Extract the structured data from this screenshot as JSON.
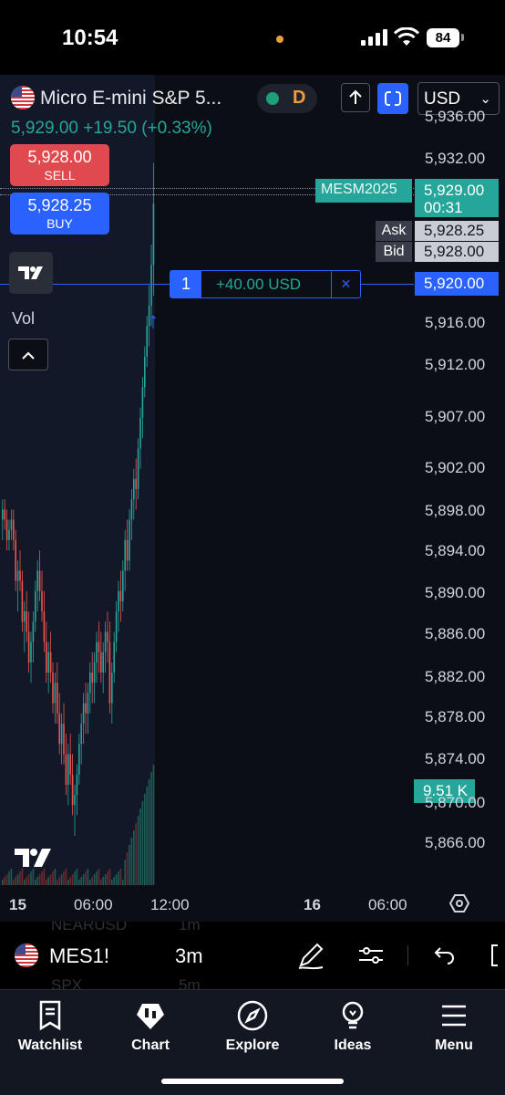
{
  "status_bar": {
    "time": "10:54",
    "battery": "84"
  },
  "chart_header": {
    "symbol_name": "Micro E-mini S&P 5...",
    "market_status": "D",
    "currency": "USD",
    "last_price": "5,929.00",
    "change": "+19.50",
    "change_pct": "(+0.33%)"
  },
  "trade_buttons": {
    "sell_price": "5,928.00",
    "sell_label": "SELL",
    "buy_price": "5,928.25",
    "buy_label": "BUY"
  },
  "indicators": {
    "vol_label": "Vol"
  },
  "price_axis": {
    "ticks": [
      "5,936.00",
      "5,932.00",
      "5,916.00",
      "5,912.00",
      "5,907.00",
      "5,902.00",
      "5,898.00",
      "5,894.00",
      "5,890.00",
      "5,886.00",
      "5,882.00",
      "5,878.00",
      "5,874.00",
      "5,870.00",
      "5,866.00"
    ]
  },
  "price_labels": {
    "contract": "MESM2025",
    "last": "5,929.00",
    "countdown": "00:31",
    "ask_label": "Ask",
    "ask": "5,928.25",
    "bid_label": "Bid",
    "bid": "5,928.00",
    "position_price": "5,920.00",
    "volume": "9.51 K"
  },
  "position": {
    "qty": "1",
    "pnl": "+40.00 USD",
    "close": "×"
  },
  "time_axis": {
    "labels": [
      "15",
      "06:00",
      "12:00",
      "16",
      "06:00"
    ]
  },
  "symbol_bar": {
    "ticker": "MES1!",
    "interval": "3m",
    "ghost_top_left": "NEARUSD",
    "ghost_top_right": "1m",
    "ghost_bottom_left": "SPX",
    "ghost_bottom_right": "5m"
  },
  "bottom_nav": {
    "items": [
      {
        "label": "Watchlist",
        "icon": "watchlist-icon"
      },
      {
        "label": "Chart",
        "icon": "chart-icon"
      },
      {
        "label": "Explore",
        "icon": "compass-icon"
      },
      {
        "label": "Ideas",
        "icon": "lightbulb-icon"
      },
      {
        "label": "Menu",
        "icon": "hamburger-icon"
      }
    ]
  },
  "colors": {
    "up": "#26a69a",
    "down": "#ef5350",
    "accent": "#2962ff",
    "warning": "#f29d38"
  },
  "candles": [
    [
      5898,
      5900,
      5896,
      5899
    ],
    [
      5899,
      5900,
      5897,
      5898
    ],
    [
      5898,
      5899,
      5895,
      5896
    ],
    [
      5896,
      5898,
      5895,
      5897
    ],
    [
      5897,
      5899,
      5896,
      5898
    ],
    [
      5898,
      5899,
      5895,
      5896
    ],
    [
      5896,
      5897,
      5891,
      5892
    ],
    [
      5892,
      5894,
      5889,
      5893
    ],
    [
      5893,
      5895,
      5891,
      5892
    ],
    [
      5892,
      5893,
      5887,
      5888
    ],
    [
      5888,
      5890,
      5885,
      5889
    ],
    [
      5889,
      5891,
      5886,
      5887
    ],
    [
      5887,
      5889,
      5883,
      5884
    ],
    [
      5884,
      5887,
      5882,
      5886
    ],
    [
      5886,
      5889,
      5884,
      5888
    ],
    [
      5888,
      5892,
      5887,
      5891
    ],
    [
      5891,
      5894,
      5889,
      5893
    ],
    [
      5893,
      5895,
      5890,
      5891
    ],
    [
      5891,
      5893,
      5888,
      5889
    ],
    [
      5889,
      5891,
      5885,
      5886
    ],
    [
      5886,
      5888,
      5882,
      5883
    ],
    [
      5883,
      5886,
      5881,
      5885
    ],
    [
      5885,
      5887,
      5882,
      5883
    ],
    [
      5883,
      5884,
      5879,
      5880
    ],
    [
      5880,
      5883,
      5878,
      5882
    ],
    [
      5882,
      5884,
      5878,
      5879
    ],
    [
      5879,
      5881,
      5875,
      5876
    ],
    [
      5876,
      5879,
      5874,
      5878
    ],
    [
      5878,
      5880,
      5874,
      5875
    ],
    [
      5875,
      5877,
      5871,
      5872
    ],
    [
      5872,
      5876,
      5870,
      5875
    ],
    [
      5875,
      5877,
      5872,
      5873
    ],
    [
      5873,
      5875,
      5869,
      5870
    ],
    [
      5870,
      5872,
      5867,
      5871
    ],
    [
      5871,
      5874,
      5869,
      5873
    ],
    [
      5873,
      5877,
      5872,
      5876
    ],
    [
      5876,
      5879,
      5874,
      5878
    ],
    [
      5878,
      5881,
      5876,
      5880
    ],
    [
      5880,
      5882,
      5877,
      5879
    ],
    [
      5879,
      5882,
      5877,
      5881
    ],
    [
      5881,
      5884,
      5879,
      5883
    ],
    [
      5883,
      5885,
      5880,
      5882
    ],
    [
      5882,
      5885,
      5880,
      5884
    ],
    [
      5884,
      5887,
      5882,
      5886
    ],
    [
      5886,
      5888,
      5883,
      5885
    ],
    [
      5885,
      5887,
      5882,
      5883
    ],
    [
      5883,
      5886,
      5881,
      5885
    ],
    [
      5885,
      5888,
      5883,
      5887
    ],
    [
      5887,
      5889,
      5884,
      5886
    ],
    [
      5886,
      5888,
      5879,
      5880
    ],
    [
      5880,
      5884,
      5878,
      5883
    ],
    [
      5883,
      5887,
      5882,
      5886
    ],
    [
      5886,
      5890,
      5885,
      5889
    ],
    [
      5889,
      5892,
      5887,
      5891
    ],
    [
      5891,
      5893,
      5888,
      5890
    ],
    [
      5890,
      5894,
      5889,
      5893
    ],
    [
      5893,
      5897,
      5891,
      5896
    ],
    [
      5896,
      5898,
      5893,
      5894
    ],
    [
      5894,
      5899,
      5893,
      5898
    ],
    [
      5898,
      5901,
      5896,
      5900
    ],
    [
      5900,
      5903,
      5898,
      5902
    ],
    [
      5902,
      5904,
      5899,
      5901
    ],
    [
      5901,
      5906,
      5900,
      5905
    ],
    [
      5905,
      5909,
      5903,
      5908
    ],
    [
      5908,
      5912,
      5906,
      5911
    ],
    [
      5911,
      5915,
      5910,
      5914
    ],
    [
      5914,
      5918,
      5913,
      5917
    ],
    [
      5917,
      5921,
      5915,
      5919
    ],
    [
      5919,
      5925,
      5917,
      5923
    ],
    [
      5923,
      5933,
      5920,
      5929
    ]
  ]
}
